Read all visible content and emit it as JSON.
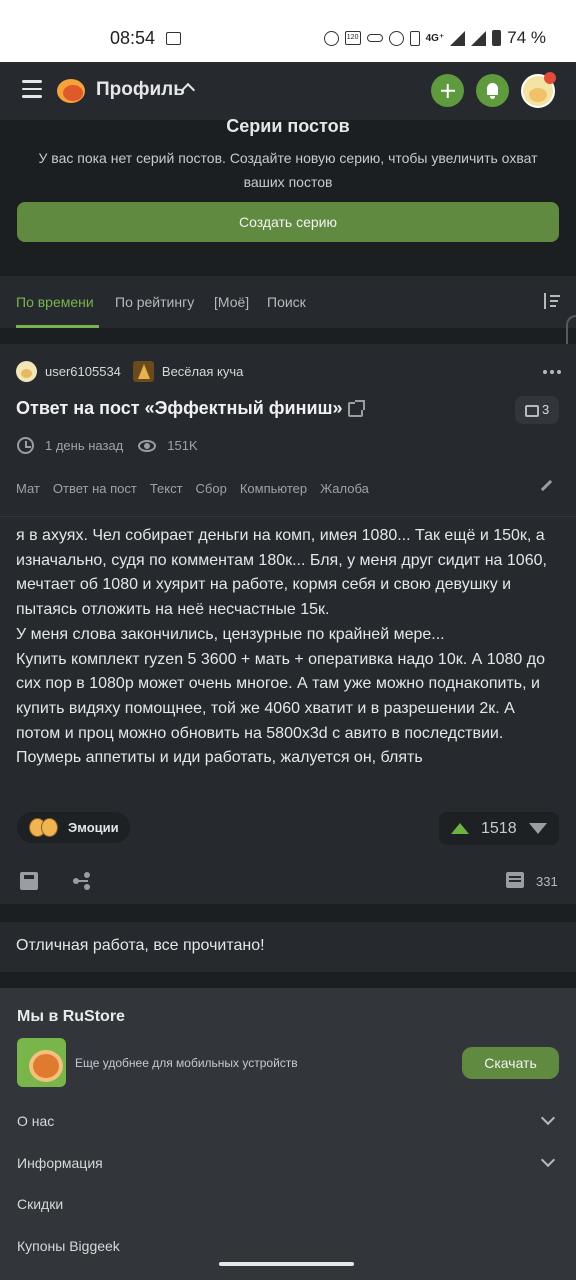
{
  "status_bar": {
    "time": "08:54",
    "network": "4G⁺",
    "battery": "74 %"
  },
  "header": {
    "title": "Профиль"
  },
  "series": {
    "title": "Серии постов",
    "description": "У вас пока нет серий постов. Создайте новую серию, чтобы увеличить охват ваших постов",
    "create_button": "Создать серию"
  },
  "tabs": [
    {
      "label": "По времени",
      "active": true
    },
    {
      "label": "По рейтингу"
    },
    {
      "label": "[Моё]"
    },
    {
      "label": "Поиск"
    }
  ],
  "post": {
    "author": "user6105534",
    "community": "Весёлая куча",
    "title": "Ответ на пост «Эффектный финиш»",
    "comments_badge": "3",
    "time": "1 день назад",
    "views": "151K",
    "tags": [
      "Мат",
      "Ответ на пост",
      "Текст",
      "Сбор",
      "Компьютер",
      "Жалоба"
    ],
    "body": [
      "я в ахуях. Чел собирает деньги на комп, имея 1080... Так ещё и 150к, а изначально, судя по комментам 180к... Бля, у меня друг сидит на 1060, мечтает об 1080 и хуярит на работе, кормя себя и свою девушку и пытаясь отложить на неё несчастные 15к.",
      "У меня слова закончились, цензурные по крайней мере...",
      "Купить комплект ryzen 5 3600 + мать + оперативка надо 10к. А 1080 до сих пор в 1080р может очень многое. А там уже можно поднакопить, и купить видяху помощнее, той же 4060 хватит и в разрешении 2к. А потом и проц можно обновить на 5800x3d с авито в последствии.",
      "Поумерь аппетиты и иди работать, жалуется он, блять"
    ],
    "emotions_label": "Эмоции",
    "rating": "1518",
    "comments_count": "331"
  },
  "read_all": "Отличная работа, все прочитано!",
  "footer": {
    "title": "Мы в RuStore",
    "promo_text": "Еще удобнее для мобильных устройств",
    "download_button": "Скачать",
    "items": [
      "О нас",
      "Информация",
      "Скидки",
      "Купоны Biggeek"
    ]
  },
  "colors": {
    "accent": "#79b34f",
    "button": "#5f8a3f",
    "background": "#1c1f22",
    "card": "#26292d"
  }
}
